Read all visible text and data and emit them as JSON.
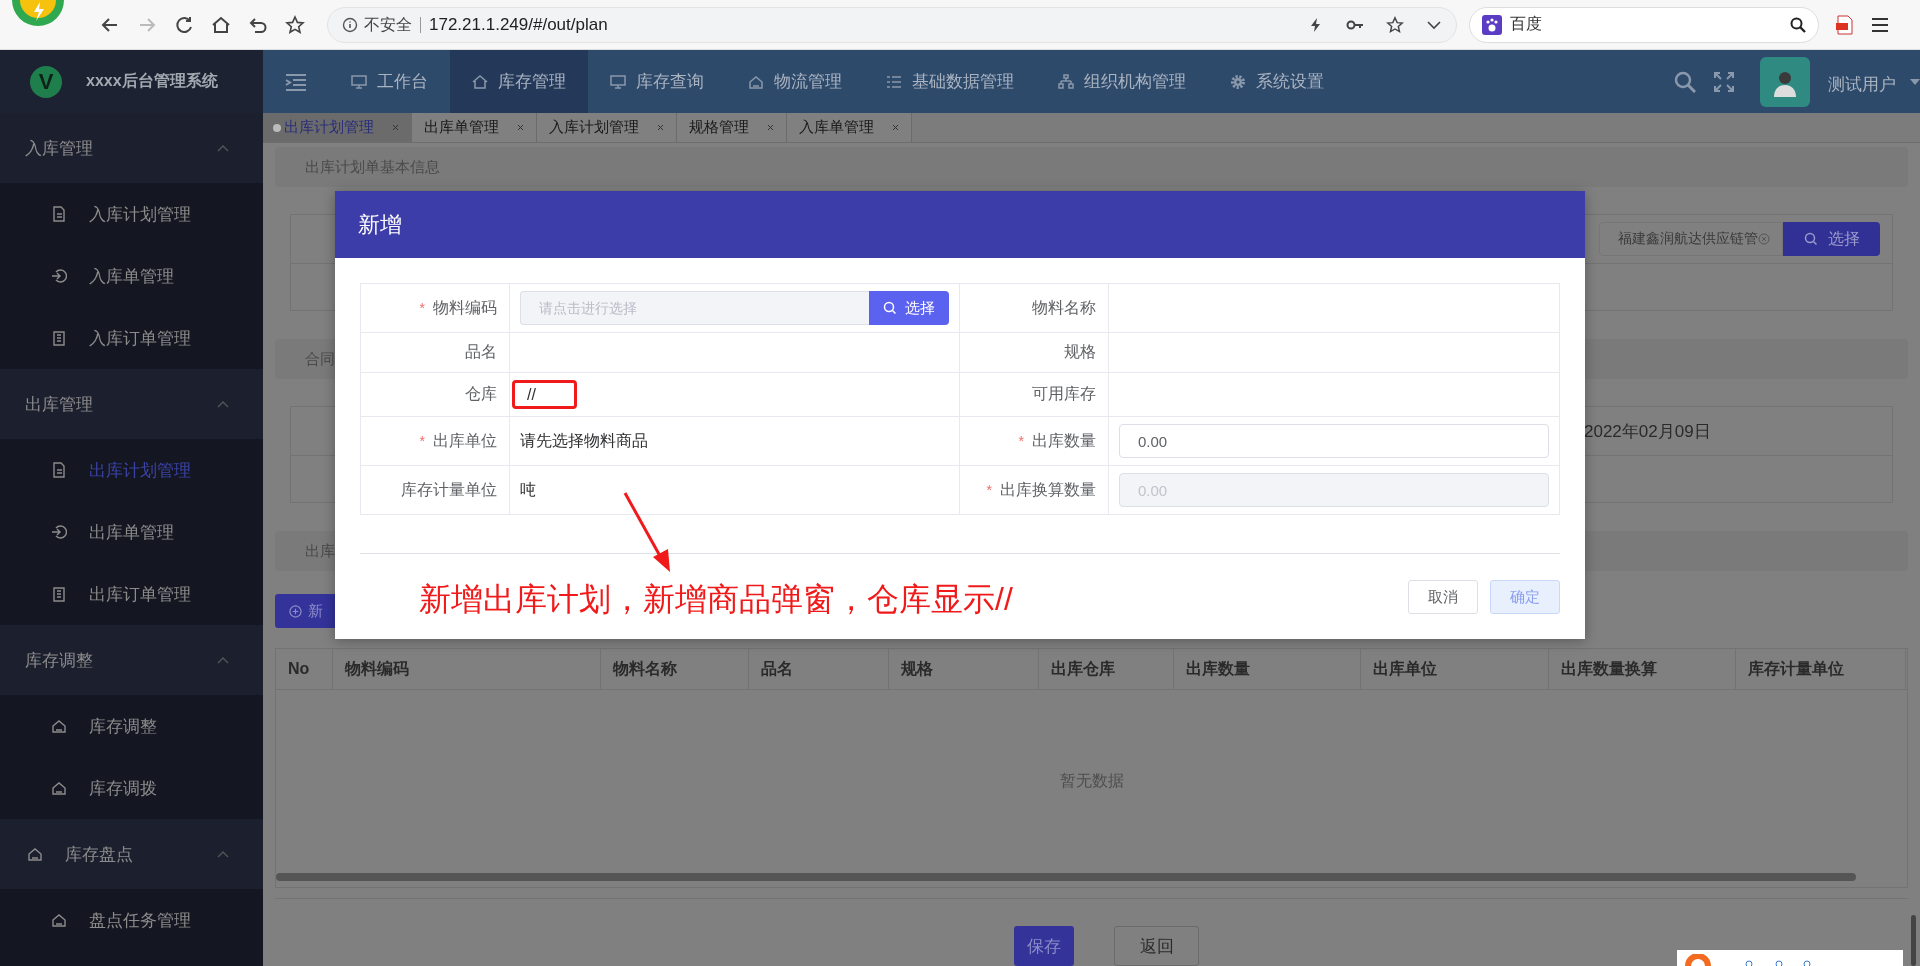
{
  "browser": {
    "security_label": "不安全",
    "url": "172.21.1.249/#/out/plan",
    "forward_disabled": true,
    "search_engine": "百度"
  },
  "app": {
    "logo_letter": "V",
    "title": "xxxx后台管理系统"
  },
  "nav": [
    {
      "label": "工作台",
      "selected": false
    },
    {
      "label": "库存管理",
      "selected": true
    },
    {
      "label": "库存查询",
      "selected": false
    },
    {
      "label": "物流管理",
      "selected": false
    },
    {
      "label": "基础数据管理",
      "selected": false
    },
    {
      "label": "组织机构管理",
      "selected": false
    },
    {
      "label": "系统设置",
      "selected": false
    }
  ],
  "user": {
    "name": "测试用户"
  },
  "sidebar": [
    {
      "label": "入库管理",
      "kind": "group",
      "expanded": true,
      "children": [
        {
          "label": "入库计划管理",
          "selected": false
        },
        {
          "label": "入库单管理",
          "selected": false
        },
        {
          "label": "入库订单管理",
          "selected": false
        }
      ]
    },
    {
      "label": "出库管理",
      "kind": "group",
      "expanded": true,
      "children": [
        {
          "label": "出库计划管理",
          "selected": true
        },
        {
          "label": "出库单管理",
          "selected": false
        },
        {
          "label": "出库订单管理",
          "selected": false
        }
      ]
    },
    {
      "label": "库存调整",
      "kind": "group",
      "expanded": true,
      "children": [
        {
          "label": "库存调整",
          "selected": false
        },
        {
          "label": "库存调拨",
          "selected": false
        }
      ]
    },
    {
      "label": "库存盘点",
      "kind": "icon-group",
      "expanded": true,
      "children": [
        {
          "label": "盘点任务管理",
          "selected": false
        }
      ]
    }
  ],
  "tabs": [
    {
      "label": "出库计划管理",
      "selected": true
    },
    {
      "label": "出库单管理",
      "selected": false
    },
    {
      "label": "入库计划管理",
      "selected": false
    },
    {
      "label": "规格管理",
      "selected": false
    },
    {
      "label": "入库单管理",
      "selected": false
    }
  ],
  "page": {
    "section_1": "出库计划单基本信息",
    "supplier": {
      "value": "福建鑫润航达供应链管",
      "button": "选择"
    },
    "section_2": "合同",
    "date": "2022年02月09日",
    "section_3": "出库",
    "add_button": "新",
    "table": {
      "columns": [
        "No",
        "物料编码",
        "物料名称",
        "品名",
        "规格",
        "出库仓库",
        "出库数量",
        "出库单位",
        "出库数量换算",
        "库存计量单位"
      ],
      "empty_text": "暂无数据"
    },
    "save_button": "保存",
    "back_button": "返回"
  },
  "dialog": {
    "title": "新增",
    "fields": [
      {
        "label": "物料编码",
        "required_mark": "*",
        "kind": "picker",
        "placeholder": "请点击进行选择",
        "button": "选择",
        "annotated": false
      },
      {
        "label": "物料名称",
        "kind": "text",
        "annotated": false
      },
      {
        "label": "品名",
        "kind": "text",
        "annotated": false
      },
      {
        "label": "规格",
        "kind": "text",
        "annotated": false
      },
      {
        "label": "仓库",
        "kind": "text",
        "value": "//",
        "annotated": true
      },
      {
        "label": "可用库存",
        "kind": "text",
        "annotated": false
      },
      {
        "label": "出库单位",
        "required_mark": "*",
        "kind": "text",
        "value": "请先选择物料商品",
        "annotated": false
      },
      {
        "label": "出库数量",
        "required_mark": "*",
        "kind": "input",
        "value": "0.00",
        "disabled": false,
        "annotated": false
      },
      {
        "label": "库存计量单位",
        "kind": "text",
        "value": "吨",
        "annotated": false
      },
      {
        "label": "出库换算数量",
        "required_mark": "*",
        "kind": "input",
        "value": "0.00",
        "disabled": true,
        "annotated": false
      }
    ],
    "cancel": {
      "label": "取消",
      "disabled": false
    },
    "confirm": {
      "label": "确定",
      "disabled": true
    }
  },
  "annotation": {
    "text": "新增出库计划，新增商品弹窗，仓库显示//"
  }
}
